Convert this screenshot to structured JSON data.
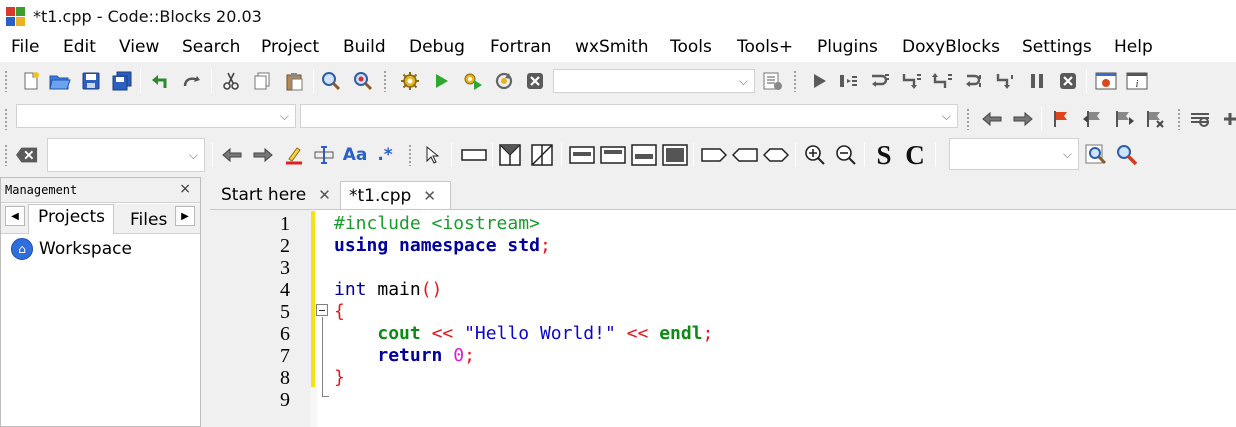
{
  "window": {
    "title": "*t1.cpp - Code::Blocks 20.03",
    "logo_colors": [
      "#d73a2b",
      "#3a9e2f",
      "#2a5fc7",
      "#e8b21e"
    ]
  },
  "menu": [
    "File",
    "Edit",
    "View",
    "Search",
    "Project",
    "Build",
    "Debug",
    "Fortran",
    "wxSmith",
    "Tools",
    "Tools+",
    "Plugins",
    "DoxyBlocks",
    "Settings",
    "Help"
  ],
  "toolbar_icons": {
    "row1": [
      "new-file-icon",
      "open-file-icon",
      "save-icon",
      "save-all-icon",
      "undo-icon",
      "redo-icon",
      "cut-icon",
      "copy-icon",
      "paste-icon",
      "find-icon",
      "replace-icon",
      "build-icon",
      "run-icon",
      "build-and-run-icon",
      "rebuild-icon",
      "abort-icon",
      "build-target-dropdown",
      "show-select-target-icon",
      "debug-run-icon",
      "run-to-cursor-icon",
      "next-line-icon",
      "step-into-icon",
      "step-out-icon",
      "next-instruction-icon",
      "step-into-instruction-icon",
      "break-debugger-icon",
      "stop-debugger-icon",
      "debugging-windows-icon",
      "info-icon"
    ],
    "row2": [
      "code-scope-dropdown",
      "code-function-dropdown",
      "jump-back-icon",
      "jump-forward-icon",
      "toggle-bookmark-icon",
      "prev-bookmark-icon",
      "next-bookmark-icon",
      "clear-bookmarks-icon",
      "thread-search-icon"
    ],
    "row3": [
      "clear-search-icon",
      "search-text-dropdown",
      "find-previous-icon",
      "find-next-icon",
      "highlight-icon",
      "selected-text-icon",
      "match-case-icon",
      "regex-icon",
      "pointer-icon",
      "rectangle-icon",
      "split-horiz-icon",
      "split-diag-icon",
      "layout-1-icon",
      "layout-2-icon",
      "layout-3-icon",
      "layout-4-icon",
      "shape-1-icon",
      "shape-2-icon",
      "shape-3-icon",
      "zoom-in-icon",
      "zoom-out-icon",
      "strike-s-icon",
      "c-icon",
      "search-scope-dropdown",
      "search-icon",
      "settings-wrench-icon"
    ]
  },
  "toolbar_text": {
    "match_case": "Aa",
    "regex": ".*",
    "bold_s": "S",
    "bold_c": "C"
  },
  "management": {
    "title": "Management",
    "close": "×",
    "tabs": [
      "Projects",
      "Files"
    ],
    "workspace": "Workspace"
  },
  "editor": {
    "tabs": [
      {
        "label": "Start here",
        "active": false
      },
      {
        "label": "*t1.cpp",
        "active": true
      }
    ],
    "tab_close": "✕",
    "line_numbers": [
      "1",
      "2",
      "3",
      "4",
      "5",
      "6",
      "7",
      "8",
      "9"
    ],
    "code": {
      "line1_pp": "#include <iostream>",
      "line2_kw1": "using",
      "line2_kw2": "namespace",
      "line2_id": "std",
      "line2_semi": ";",
      "line4_type": "int",
      "line4_fn": "main",
      "line4_paren": "()",
      "line5_brace": "{",
      "line6_cout": "cout",
      "line6_op1": "<<",
      "line6_str": "\"Hello World!\"",
      "line6_op2": "<<",
      "line6_endl": "endl",
      "line6_semi": ";",
      "line7_kw": "return",
      "line7_num": "0",
      "line7_semi": ";",
      "line8_brace": "}"
    },
    "colors": {
      "keyword": "#00009f",
      "preprocessor": "#1a9c2c",
      "operator": "#e0171b",
      "string": "#0b07c9",
      "number": "#e01bd3",
      "change_bar": "#f2e21a"
    }
  }
}
